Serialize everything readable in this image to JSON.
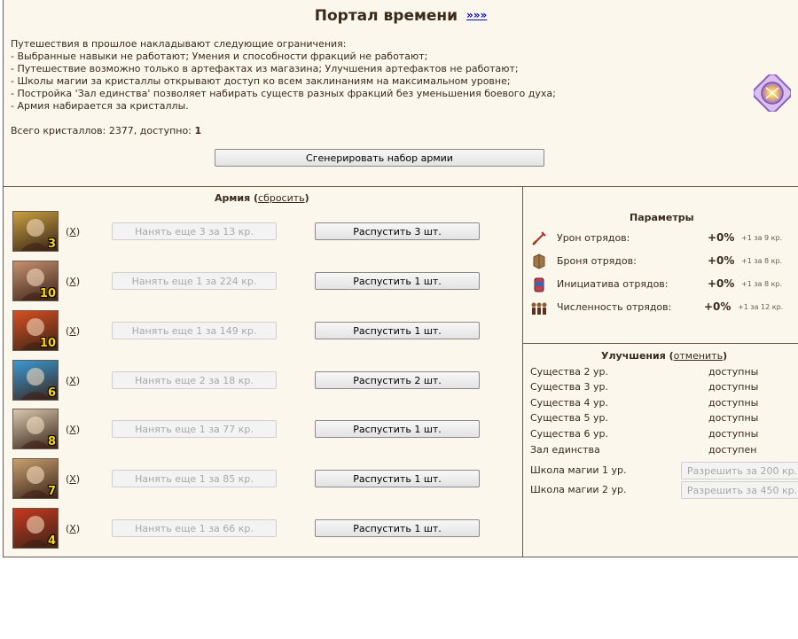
{
  "header": {
    "title": "Портал времени",
    "more_link": "»»»"
  },
  "intro": {
    "lines": [
      "Путешествия в прошлое накладывают следующие ограничения:",
      "- Выбранные навыки не работают; Умения и способности фракций не работают;",
      "- Путешествие возможно только в артефактах из магазина; Улучшения артефактов не работают;",
      "- Школы магии за кристаллы открывают доступ ко всем заклинаниям на максимальном уровне;",
      "- Постройка 'Зал единства' позволяет набирать существ разных фракций без уменьшения боевого духа;",
      "- Армия набирается за кристаллы."
    ],
    "crystals_label": "Всего кристаллов: 2377, доступно:",
    "crystals_available": "1"
  },
  "generate_button": "Сгенерировать набор армии",
  "army": {
    "title": "Армия",
    "reset_label": "сбросить",
    "remove_label": "X",
    "units": [
      {
        "count": "3",
        "hire": "Нанять еще 3 за 13 кр.",
        "dismiss": "Распустить 3 шт.",
        "color": "#c8a040"
      },
      {
        "count": "10",
        "hire": "Нанять еще 1 за 224 кр.",
        "dismiss": "Распустить 1 шт.",
        "color": "#c89070"
      },
      {
        "count": "10",
        "hire": "Нанять еще 1 за 149 кр.",
        "dismiss": "Распустить 1 шт.",
        "color": "#d85020"
      },
      {
        "count": "6",
        "hire": "Нанять еще 2 за 18 кр.",
        "dismiss": "Распустить 2 шт.",
        "color": "#3a9ad8"
      },
      {
        "count": "8",
        "hire": "Нанять еще 1 за 77 кр.",
        "dismiss": "Распустить 1 шт.",
        "color": "#d8c8b0"
      },
      {
        "count": "7",
        "hire": "Нанять еще 1 за 85 кр.",
        "dismiss": "Распустить 1 шт.",
        "color": "#c8a070"
      },
      {
        "count": "4",
        "hire": "Нанять еще 1 за 66 кр.",
        "dismiss": "Распустить 1 шт.",
        "color": "#c83820"
      }
    ]
  },
  "params": {
    "title": "Параметры",
    "items": [
      {
        "icon": "sword-icon",
        "label": "Урон отрядов:",
        "value": "+0%",
        "step": "+1 за 9 кр."
      },
      {
        "icon": "armor-icon",
        "label": "Броня отрядов:",
        "value": "+0%",
        "step": "+1 за 8 кр."
      },
      {
        "icon": "potion-icon",
        "label": "Инициатива отрядов:",
        "value": "+0%",
        "step": "+1 за 8 кр."
      },
      {
        "icon": "troops-icon",
        "label": "Численность отрядов:",
        "value": "+0%",
        "step": "+1 за 12 кр."
      }
    ]
  },
  "upgrades": {
    "title": "Улучшения",
    "cancel_label": "отменить",
    "items": [
      {
        "label": "Существа 2 ур.",
        "status": "доступны"
      },
      {
        "label": "Существа 3 ур.",
        "status": "доступны"
      },
      {
        "label": "Существа 4 ур.",
        "status": "доступны"
      },
      {
        "label": "Существа 5 ур.",
        "status": "доступны"
      },
      {
        "label": "Существа 6 ур.",
        "status": "доступны"
      },
      {
        "label": "Зал единства",
        "status": "доступен"
      }
    ],
    "magic": [
      {
        "label": "Школа магии 1 ур.",
        "button": "Разрешить за 200 кр."
      },
      {
        "label": "Школа магии 2 ур.",
        "button": "Разрешить за 450 кр."
      }
    ]
  }
}
